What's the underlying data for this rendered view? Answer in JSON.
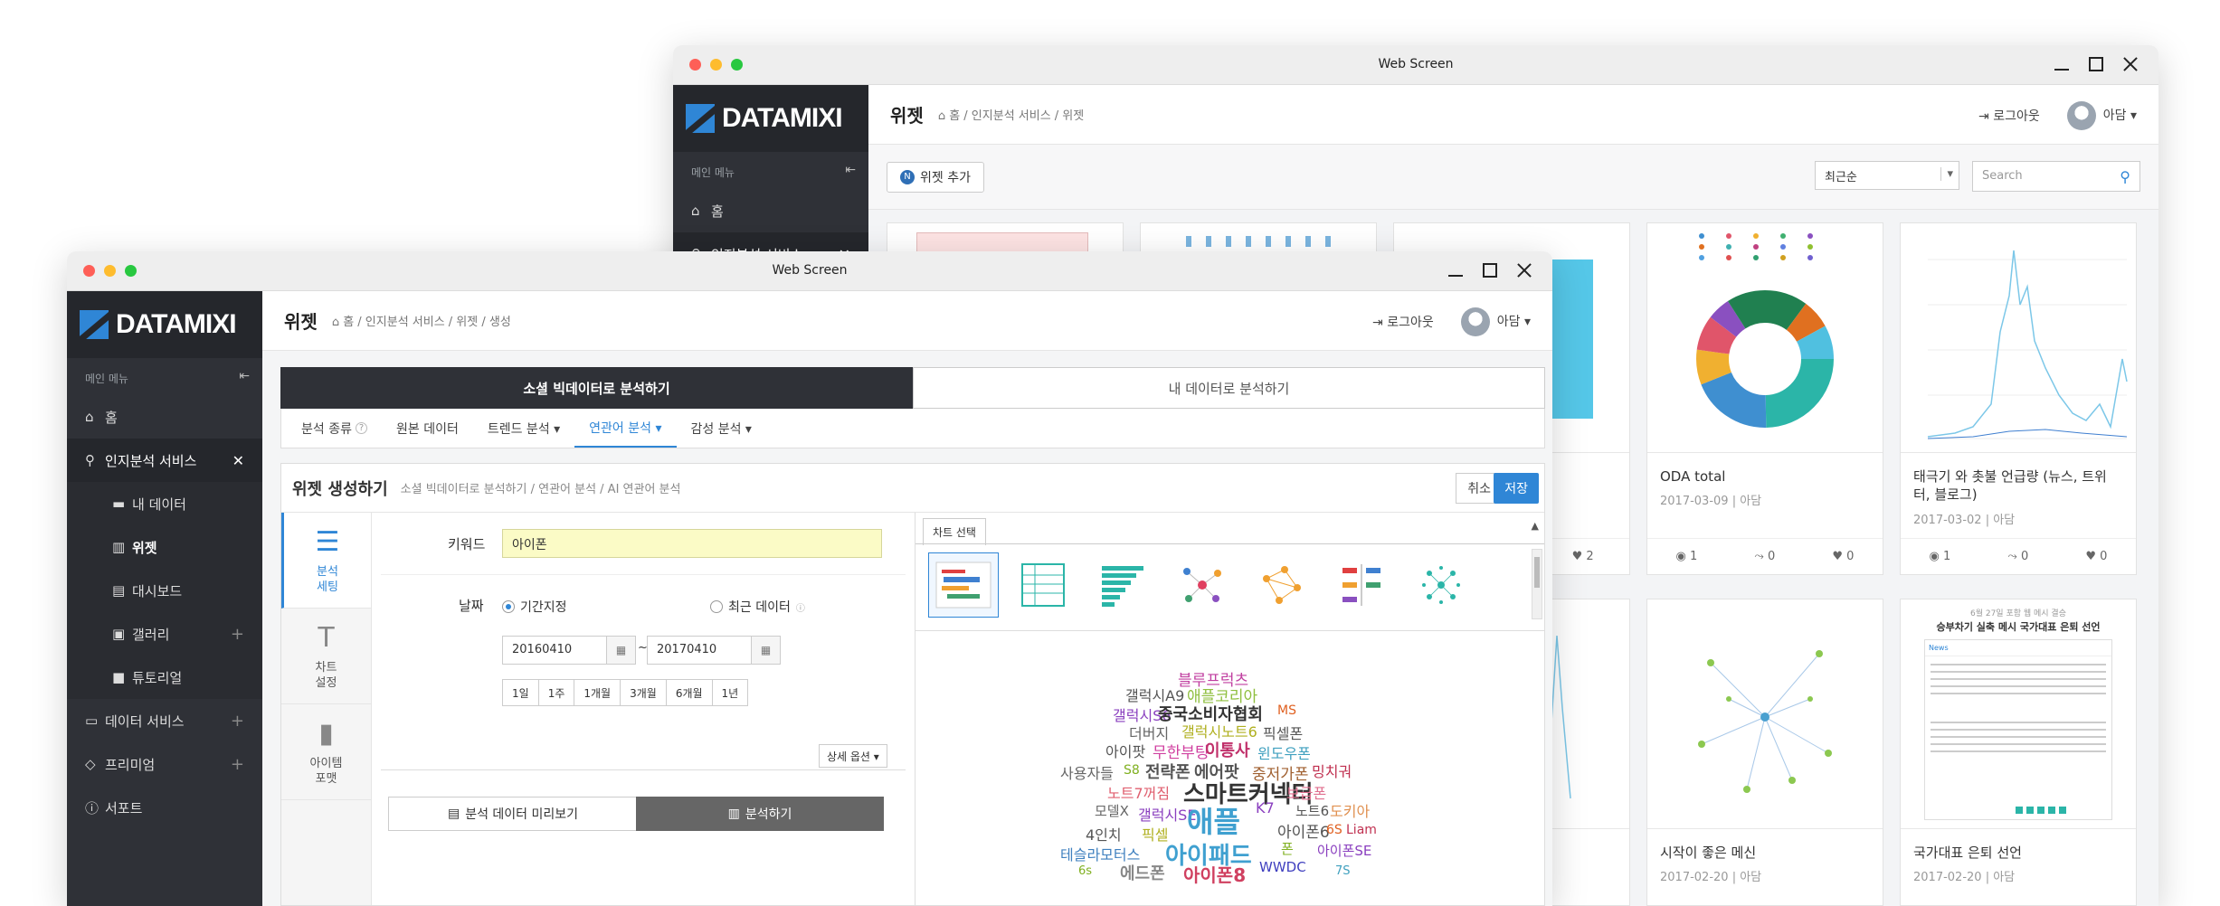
{
  "window": {
    "title": "Web Screen"
  },
  "brand": {
    "logo_text": "DATAMIXI",
    "accent": "#2f86d6"
  },
  "sidebar": {
    "menu_label": "메인 메뉴",
    "items": [
      {
        "label": "홈",
        "icon": "home-icon"
      },
      {
        "label": "인지분석 서비스",
        "icon": "search-icon",
        "active": true
      },
      {
        "label": "데이터 서비스",
        "icon": "monitor-icon"
      },
      {
        "label": "프리미엄",
        "icon": "diamond-icon"
      },
      {
        "label": "서포트",
        "icon": "info-icon"
      }
    ],
    "sub_items": [
      {
        "label": "내 데이터",
        "icon": "folder-icon"
      },
      {
        "label": "위젯",
        "icon": "bar-chart-icon"
      },
      {
        "label": "대시보드",
        "icon": "clipboard-icon"
      },
      {
        "label": "갤러리",
        "icon": "image-icon"
      },
      {
        "label": "튜토리얼",
        "icon": "video-icon"
      }
    ]
  },
  "header": {
    "logout_label": "로그아웃",
    "user_name": "아담"
  },
  "back": {
    "page_title": "위젯",
    "breadcrumb": "홈 / 인지분석 서비스 / 위젯",
    "add_button": "위젯 추가",
    "add_badge": "N",
    "sort_value": "최근순",
    "search_placeholder": "Search",
    "cards": [
      {
        "title": "ODA total",
        "date": "2017-03-09",
        "author": "아담",
        "views": "1",
        "shares": "0",
        "likes": "0"
      },
      {
        "title": "태극기 와 촛불 언급량 (뉴스, 트위터, 블로그)",
        "date": "2017-03-02",
        "author": "아담",
        "views": "1",
        "shares": "0",
        "likes": "0"
      },
      {
        "title": "시작이 좋은 메신",
        "date": "2017-02-20",
        "author": "아담"
      },
      {
        "title": "국가대표 은퇴 선언",
        "date": "2017-02-20",
        "author": "아담"
      }
    ],
    "partial_card_likes": "2",
    "news_thumb_title": "승부차기 실축 메시 국가대표 은퇴 선언",
    "news_thumb_date": "6월 27일 포함 웹 메시 결승",
    "news_thumb_tab": "News"
  },
  "front": {
    "page_title": "위젯",
    "breadcrumb": "홈 / 인지분석 서비스 / 위젯 / 생성",
    "mode_tabs": [
      "소셜 빅데이터로 분석하기",
      "내 데이터로 분석하기"
    ],
    "sub_tabs": [
      "분석 종류",
      "원본 데이터",
      "트렌드 분석 ▾",
      "연관어 분석 ▾",
      "감성 분석 ▾"
    ],
    "panel_title": "위젯 생성하기",
    "panel_breadcrumb": "소셜 빅데이터로 분석하기 / 연관어 분석 / AI 연관어 분석",
    "cancel_label": "취소",
    "save_label": "저장",
    "vtabs": [
      "분석\n세팅",
      "차트\n설정",
      "아이템\n포맷"
    ],
    "keyword_label": "키워드",
    "keyword_value": "아이폰",
    "date_label": "날짜",
    "radio_period": "기간지정",
    "radio_recent": "최근 데이터",
    "date_from": "20160410",
    "date_to": "20170410",
    "date_sep": "~",
    "quick_ranges": [
      "1일",
      "1주",
      "1개월",
      "3개월",
      "6개월",
      "1년"
    ],
    "detail_options": "상세 옵션 ▾",
    "preview_button": "분석 데이터 미리보기",
    "analyze_button": "분석하기",
    "chart_select_tab": "차트 선택",
    "wordcloud": [
      {
        "text": "블루프럭츠",
        "color": "#c03fa0"
      },
      {
        "text": "갤럭시A9",
        "color": "#555555"
      },
      {
        "text": "애플코리아",
        "color": "#8fbf3f"
      },
      {
        "text": "갤럭시S6",
        "color": "#8a3fbf"
      },
      {
        "text": "중국소비자협회",
        "color": "#333333"
      },
      {
        "text": "MS",
        "color": "#e06020"
      },
      {
        "text": "더버지",
        "color": "#666666"
      },
      {
        "text": "갤럭시노트6",
        "color": "#b0b020"
      },
      {
        "text": "픽셀폰",
        "color": "#555555"
      },
      {
        "text": "아이팟",
        "color": "#555555"
      },
      {
        "text": "무한부팅",
        "color": "#d040a0"
      },
      {
        "text": "이통사",
        "color": "#c0306a"
      },
      {
        "text": "윈도우폰",
        "color": "#3fa0bf"
      },
      {
        "text": "사용자들",
        "color": "#666666"
      },
      {
        "text": "S8",
        "color": "#80b020"
      },
      {
        "text": "전략폰",
        "color": "#555555"
      },
      {
        "text": "에어팟",
        "color": "#555555"
      },
      {
        "text": "중저가폰",
        "color": "#a06030"
      },
      {
        "text": "밍치궈",
        "color": "#c03050"
      },
      {
        "text": "노트7꺼짐",
        "color": "#e06070"
      },
      {
        "text": "스마트커넥터",
        "color": "#333333"
      },
      {
        "text": "보급폰",
        "color": "#e07090"
      },
      {
        "text": "모델X",
        "color": "#666666"
      },
      {
        "text": "갤럭시SE",
        "color": "#8a3fbf"
      },
      {
        "text": "애플",
        "color": "#3fa0d0"
      },
      {
        "text": "K7",
        "color": "#8a3fbf"
      },
      {
        "text": "노트6",
        "color": "#555555"
      },
      {
        "text": "도키아",
        "color": "#e09050"
      },
      {
        "text": "4인치",
        "color": "#555555"
      },
      {
        "text": "픽셀",
        "color": "#b0b020"
      },
      {
        "text": "아이폰6",
        "color": "#555555"
      },
      {
        "text": "6S",
        "color": "#e06020"
      },
      {
        "text": "Liam",
        "color": "#c03050"
      },
      {
        "text": "테슬라모터스",
        "color": "#3f80bf"
      },
      {
        "text": "아이패드",
        "color": "#3fa0d0"
      },
      {
        "text": "폰",
        "color": "#80b020"
      },
      {
        "text": "아이폰SE",
        "color": "#8a3fbf"
      },
      {
        "text": "6s",
        "color": "#80b020"
      },
      {
        "text": "에드폰",
        "color": "#888888"
      },
      {
        "text": "아이폰8",
        "color": "#d04060"
      },
      {
        "text": "WWDC",
        "color": "#3f3fbf"
      },
      {
        "text": "7S",
        "color": "#3fa0bf"
      }
    ]
  }
}
